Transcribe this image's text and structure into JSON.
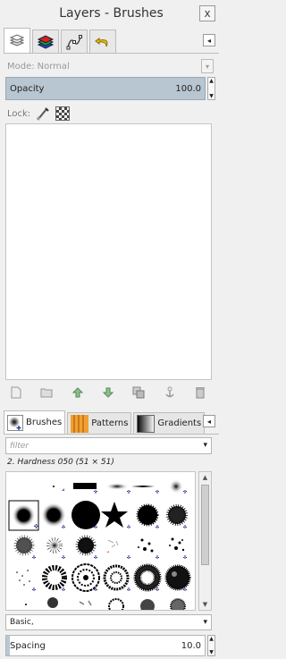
{
  "window": {
    "title": "Layers - Brushes",
    "close_label": "x"
  },
  "top_tabs": [
    {
      "icon": "layers-icon"
    },
    {
      "icon": "channels-icon"
    },
    {
      "icon": "paths-icon"
    },
    {
      "icon": "undo-history-icon"
    }
  ],
  "layers": {
    "mode_label": "Mode:",
    "mode_value": "Normal",
    "opacity_label": "Opacity",
    "opacity_value": "100.0",
    "lock_label": "Lock:"
  },
  "layer_buttons": [
    "new-layer-icon",
    "new-layer-group-icon",
    "raise-layer-icon",
    "lower-layer-icon",
    "duplicate-layer-icon",
    "anchor-layer-icon",
    "delete-layer-icon"
  ],
  "bottom_tabs": [
    {
      "label": "Brushes",
      "icon": "brushes-tab-icon"
    },
    {
      "label": "Patterns",
      "icon": "patterns-tab-icon"
    },
    {
      "label": "Gradients",
      "icon": "gradients-tab-icon"
    }
  ],
  "brushes": {
    "filter_placeholder": "filter",
    "selected_name": "2. Hardness 050 (51 × 51)",
    "preset": "Basic,",
    "spacing_label": "Spacing",
    "spacing_value": "10.0"
  }
}
